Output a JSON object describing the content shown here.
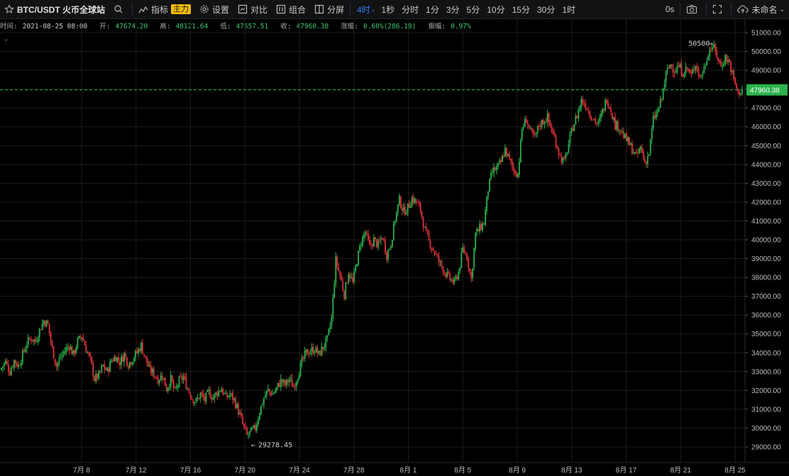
{
  "toolbar": {
    "symbol": "BTC/USDT 火币全球站",
    "indicators_label": "指标",
    "indicators_badge": "主力",
    "settings_label": "设置",
    "compare_label": "对比",
    "combo_label": "组合",
    "split_label": "分屏",
    "intervals": [
      "4时",
      "1秒",
      "分时",
      "1分",
      "3分",
      "5分",
      "10分",
      "15分",
      "30分",
      "1时"
    ],
    "active_interval": "4时",
    "countdown": "0s",
    "layout_name": "未命名"
  },
  "info": {
    "time_label": "时间:",
    "time": "2021-08-25 08:00",
    "open_label": "开:",
    "open": "47674.20",
    "high_label": "高:",
    "high": "48121.64",
    "low_label": "低:",
    "low": "47657.51",
    "close_label": "收:",
    "close": "47960.38",
    "change_label": "涨幅:",
    "change": "0.60%(286.18)",
    "amplitude_label": "振幅:",
    "amplitude": "0.97%"
  },
  "colors": {
    "up": "#2bb24c",
    "down": "#e0313a",
    "grid": "#1c1c1c",
    "last_price": "#2bb24c",
    "active": "#2f7ef8",
    "badge": "#f0b90b"
  },
  "chart_data": {
    "type": "candlestick",
    "interval": "4时",
    "last_price": "47960.38",
    "high_annotation": "50500",
    "low_annotation": "29278.45",
    "y_ticks": [
      "51000.00",
      "50000.00",
      "49000.00",
      "48000.00",
      "47000.00",
      "46000.00",
      "45000.00",
      "44000.00",
      "43000.00",
      "42000.00",
      "41000.00",
      "40000.00",
      "39000.00",
      "38000.00",
      "37000.00",
      "36000.00",
      "35000.00",
      "34000.00",
      "33000.00",
      "32000.00",
      "31000.00",
      "30000.00",
      "29000.00"
    ],
    "x_ticks": [
      "7月 8",
      "7月 12",
      "7月 16",
      "7月 20",
      "7月 24",
      "7月 28",
      "8月 1",
      "8月 5",
      "8月 9",
      "8月 13",
      "8月 17",
      "8月 21",
      "8月 25"
    ],
    "ylim": [
      28500,
      51500
    ],
    "close_path": [
      [
        0,
        33200
      ],
      [
        3,
        33500
      ],
      [
        6,
        33000
      ],
      [
        9,
        33600
      ],
      [
        12,
        33300
      ],
      [
        15,
        33900
      ],
      [
        18,
        34500
      ],
      [
        21,
        34800
      ],
      [
        24,
        34600
      ],
      [
        27,
        35200
      ],
      [
        30,
        35700
      ],
      [
        33,
        35500
      ],
      [
        36,
        34200
      ],
      [
        39,
        33300
      ],
      [
        42,
        33800
      ],
      [
        45,
        34100
      ],
      [
        48,
        34400
      ],
      [
        51,
        33900
      ],
      [
        54,
        34600
      ],
      [
        57,
        34900
      ],
      [
        60,
        34200
      ],
      [
        63,
        33600
      ],
      [
        66,
        32600
      ],
      [
        69,
        32800
      ],
      [
        72,
        33300
      ],
      [
        75,
        33000
      ],
      [
        78,
        33600
      ],
      [
        81,
        33800
      ],
      [
        84,
        33500
      ],
      [
        87,
        33900
      ],
      [
        90,
        33400
      ],
      [
        93,
        33700
      ],
      [
        96,
        34000
      ],
      [
        99,
        34400
      ],
      [
        102,
        33700
      ],
      [
        105,
        33100
      ],
      [
        108,
        32900
      ],
      [
        111,
        32600
      ],
      [
        114,
        32800
      ],
      [
        117,
        32100
      ],
      [
        120,
        32600
      ],
      [
        123,
        31900
      ],
      [
        126,
        32500
      ],
      [
        129,
        32700
      ],
      [
        132,
        32100
      ],
      [
        135,
        31600
      ],
      [
        138,
        31400
      ],
      [
        141,
        31800
      ],
      [
        144,
        31500
      ],
      [
        147,
        31900
      ],
      [
        150,
        31600
      ],
      [
        153,
        31900
      ],
      [
        156,
        32100
      ],
      [
        159,
        31600
      ],
      [
        162,
        31800
      ],
      [
        165,
        31500
      ],
      [
        168,
        30900
      ],
      [
        171,
        30200
      ],
      [
        174,
        29600
      ],
      [
        177,
        29800
      ],
      [
        180,
        30000
      ],
      [
        183,
        30900
      ],
      [
        186,
        31600
      ],
      [
        189,
        32000
      ],
      [
        192,
        31800
      ],
      [
        195,
        32100
      ],
      [
        198,
        32500
      ],
      [
        201,
        32300
      ],
      [
        204,
        32600
      ],
      [
        207,
        32200
      ],
      [
        210,
        32800
      ],
      [
        213,
        33500
      ],
      [
        216,
        34000
      ],
      [
        219,
        34100
      ],
      [
        222,
        34200
      ],
      [
        225,
        33900
      ],
      [
        228,
        34300
      ],
      [
        231,
        34700
      ],
      [
        234,
        35800
      ],
      [
        237,
        38900
      ],
      [
        240,
        38100
      ],
      [
        243,
        37100
      ],
      [
        246,
        38300
      ],
      [
        249,
        37700
      ],
      [
        252,
        38900
      ],
      [
        255,
        39900
      ],
      [
        258,
        40400
      ],
      [
        261,
        39600
      ],
      [
        264,
        40000
      ],
      [
        267,
        39700
      ],
      [
        270,
        40200
      ],
      [
        273,
        39200
      ],
      [
        276,
        39800
      ],
      [
        279,
        41100
      ],
      [
        282,
        42100
      ],
      [
        285,
        41500
      ],
      [
        288,
        41700
      ],
      [
        291,
        42200
      ],
      [
        294,
        42000
      ],
      [
        297,
        41600
      ],
      [
        300,
        40500
      ],
      [
        303,
        39900
      ],
      [
        306,
        39500
      ],
      [
        309,
        39000
      ],
      [
        312,
        38600
      ],
      [
        315,
        38200
      ],
      [
        318,
        37900
      ],
      [
        321,
        37700
      ],
      [
        324,
        38300
      ],
      [
        327,
        39500
      ],
      [
        330,
        39100
      ],
      [
        333,
        37900
      ],
      [
        336,
        40300
      ],
      [
        339,
        40600
      ],
      [
        342,
        40900
      ],
      [
        345,
        42700
      ],
      [
        348,
        43600
      ],
      [
        351,
        43800
      ],
      [
        354,
        44100
      ],
      [
        357,
        44800
      ],
      [
        360,
        44200
      ],
      [
        363,
        43700
      ],
      [
        366,
        43500
      ],
      [
        369,
        45900
      ],
      [
        372,
        46400
      ],
      [
        375,
        45700
      ],
      [
        378,
        45400
      ],
      [
        381,
        46100
      ],
      [
        384,
        46300
      ],
      [
        387,
        46500
      ],
      [
        390,
        45800
      ],
      [
        393,
        45200
      ],
      [
        396,
        44400
      ],
      [
        399,
        44100
      ],
      [
        402,
        45100
      ],
      [
        405,
        46000
      ],
      [
        408,
        46600
      ],
      [
        411,
        47400
      ],
      [
        414,
        47200
      ],
      [
        417,
        46700
      ],
      [
        420,
        46400
      ],
      [
        423,
        46100
      ],
      [
        426,
        46800
      ],
      [
        429,
        47500
      ],
      [
        432,
        46900
      ],
      [
        435,
        46100
      ],
      [
        438,
        46000
      ],
      [
        441,
        45500
      ],
      [
        444,
        45200
      ],
      [
        447,
        44800
      ],
      [
        450,
        44400
      ],
      [
        453,
        44900
      ],
      [
        456,
        44100
      ],
      [
        459,
        44600
      ],
      [
        462,
        46400
      ],
      [
        465,
        46800
      ],
      [
        468,
        47500
      ],
      [
        471,
        48800
      ],
      [
        474,
        49300
      ],
      [
        477,
        49000
      ],
      [
        480,
        49200
      ],
      [
        483,
        48900
      ],
      [
        486,
        49100
      ],
      [
        489,
        48700
      ],
      [
        492,
        49400
      ],
      [
        495,
        48600
      ],
      [
        498,
        49100
      ],
      [
        501,
        50000
      ],
      [
        504,
        50300
      ],
      [
        507,
        49800
      ],
      [
        510,
        49200
      ],
      [
        513,
        49700
      ],
      [
        516,
        49400
      ],
      [
        519,
        48500
      ],
      [
        522,
        47800
      ],
      [
        525,
        47960
      ]
    ]
  }
}
